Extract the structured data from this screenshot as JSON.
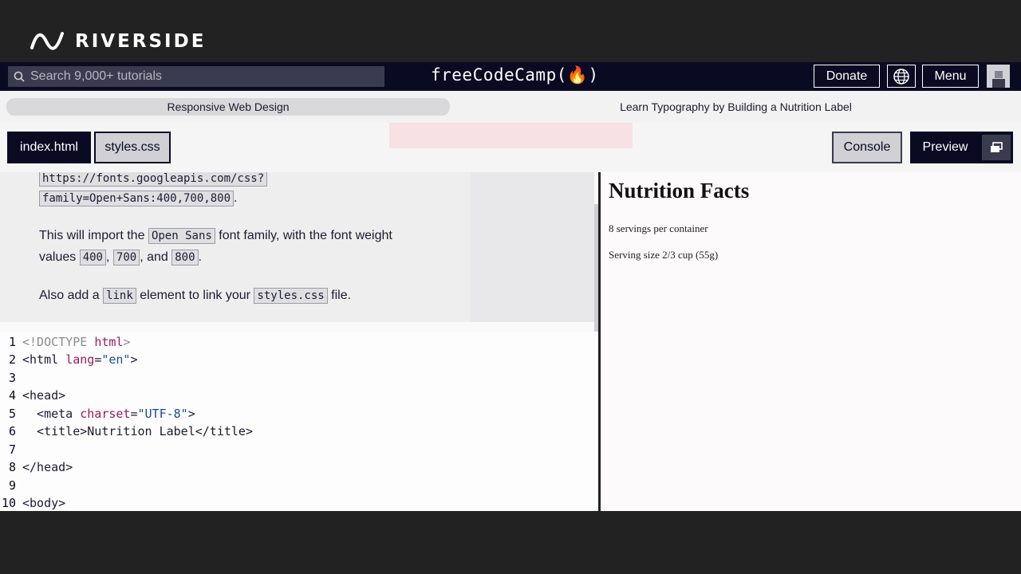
{
  "watermark": {
    "brand": "RIVERSIDE"
  },
  "navbar": {
    "search_placeholder": "Search 9,000+ tutorials",
    "brand": "freeCodeCamp(🔥)",
    "donate": "Donate",
    "menu": "Menu"
  },
  "breadcrumbs": {
    "course": "Responsive Web Design",
    "project": "Learn Typography by Building a Nutrition Label"
  },
  "tabs": {
    "index": "index.html",
    "styles": "styles.css"
  },
  "actions": {
    "console": "Console",
    "preview": "Preview"
  },
  "instructions": {
    "url_line1": "https://fonts.googleapis.com/css?",
    "url_line2": "family=Open+Sans:400,700,800",
    "url_period": ".",
    "p1_a": "This will import the",
    "p1_code": "Open Sans",
    "p1_b": "font family, with the font weight",
    "p2_a": "values",
    "w400": "400",
    "comma": ",",
    "w700": "700",
    "and": ", and",
    "w800": "800",
    "p2_end": ".",
    "p3_a": "Also add a",
    "p3_code1": "link",
    "p3_b": "element to link your",
    "p3_code2": "styles.css",
    "p3_c": "file."
  },
  "code_lines": [
    {
      "n": "1",
      "doc": "<!DOCTYPE ",
      "attr": "html",
      "doc2": ">"
    },
    {
      "n": "2",
      "t1": "<html ",
      "attr": "lang",
      "t2": "=",
      "str": "\"en\"",
      "t3": ">"
    },
    {
      "n": "3"
    },
    {
      "n": "4",
      "t1": "<head>"
    },
    {
      "n": "5",
      "t1": "  <meta ",
      "attr": "charset",
      "t2": "=",
      "str": "\"UTF-8\"",
      "t3": ">"
    },
    {
      "n": "6",
      "t1": "  <title>Nutrition Label</title>"
    },
    {
      "n": "7"
    },
    {
      "n": "8",
      "t1": "</head>"
    },
    {
      "n": "9"
    },
    {
      "n": "10",
      "t1": "<body>"
    }
  ],
  "preview": {
    "title": "Nutrition Facts",
    "servings": "8 servings per container",
    "serving_size": "Serving size 2/3 cup (55g)"
  }
}
